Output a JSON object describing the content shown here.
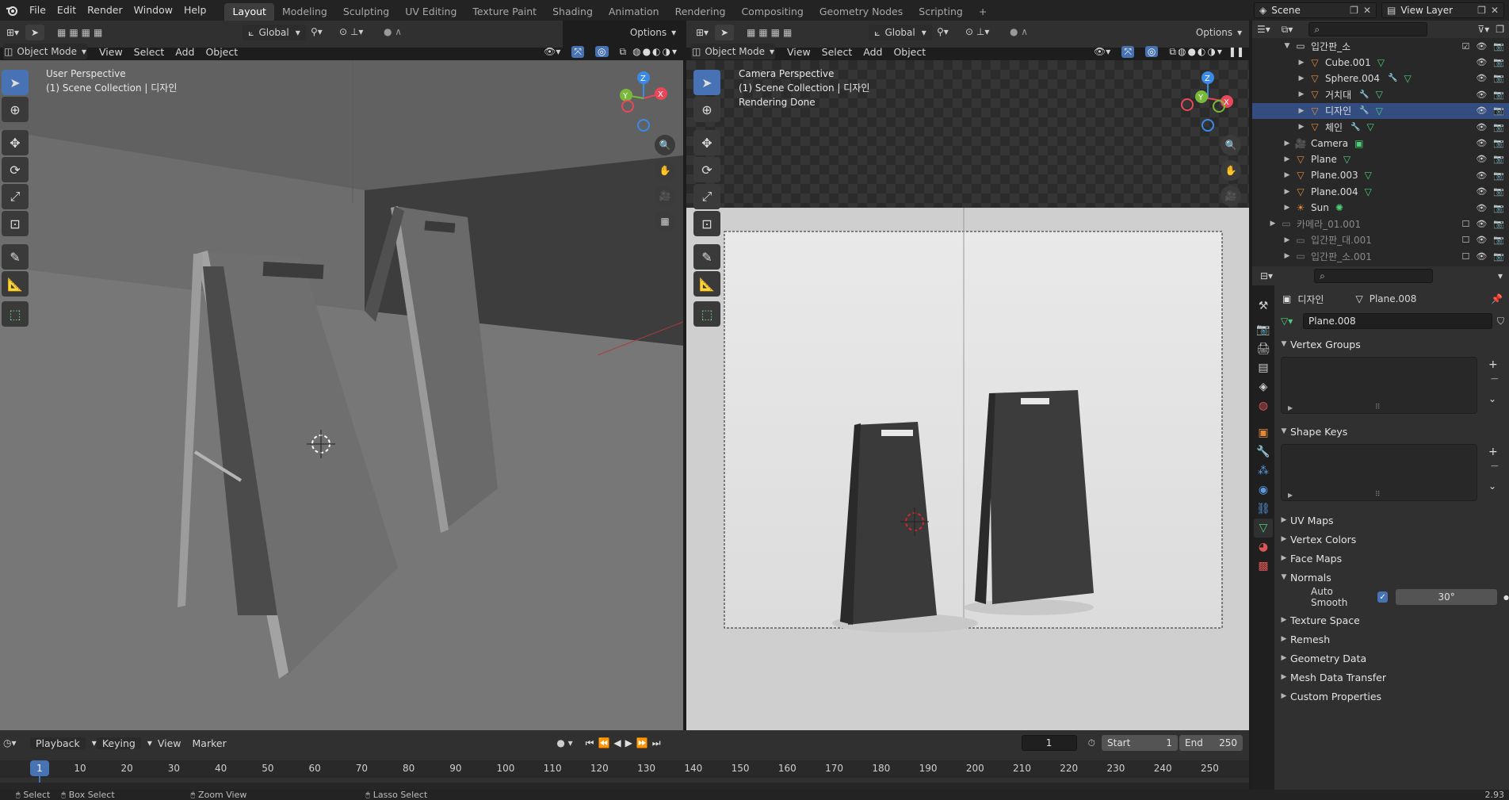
{
  "topbar": {
    "menus": [
      "File",
      "Edit",
      "Render",
      "Window",
      "Help"
    ],
    "workspaces": [
      "Layout",
      "Modeling",
      "Sculpting",
      "UV Editing",
      "Texture Paint",
      "Shading",
      "Animation",
      "Rendering",
      "Compositing",
      "Geometry Nodes",
      "Scripting"
    ],
    "add_tab": "+",
    "scene_label": "Scene",
    "view_layer_label": "View Layer"
  },
  "viewport_left": {
    "mode": "Object Mode",
    "menus": [
      "View",
      "Select",
      "Add",
      "Object"
    ],
    "transform_orientation": "Global",
    "options_label": "Options",
    "perspective": "User Perspective",
    "collection": "(1) Scene Collection | 디자인"
  },
  "viewport_right": {
    "mode": "Object Mode",
    "menus": [
      "View",
      "Select",
      "Add",
      "Object"
    ],
    "transform_orientation": "Global",
    "options_label": "Options",
    "perspective": "Camera Perspective",
    "collection": "(1) Scene Collection | 디자인",
    "status": "Rendering Done"
  },
  "gizmo": {
    "x": "X",
    "y": "Y",
    "z": "Z"
  },
  "outliner": {
    "rows": [
      {
        "name": "입간판_소",
        "indent": 1,
        "type": "collection"
      },
      {
        "name": "Cube.001",
        "indent": 2,
        "type": "mesh"
      },
      {
        "name": "Sphere.004",
        "indent": 2,
        "type": "mesh"
      },
      {
        "name": "거치대",
        "indent": 2,
        "type": "mesh"
      },
      {
        "name": "디자인",
        "indent": 2,
        "type": "mesh",
        "selected": true
      },
      {
        "name": "체인",
        "indent": 2,
        "type": "mesh"
      },
      {
        "name": "Camera",
        "indent": 1,
        "type": "camera"
      },
      {
        "name": "Plane",
        "indent": 1,
        "type": "mesh"
      },
      {
        "name": "Plane.003",
        "indent": 1,
        "type": "mesh"
      },
      {
        "name": "Plane.004",
        "indent": 1,
        "type": "mesh"
      },
      {
        "name": "Sun",
        "indent": 1,
        "type": "light"
      },
      {
        "name": "카메라_01.001",
        "indent": 0,
        "type": "collection",
        "dim": true
      },
      {
        "name": "입간판_대.001",
        "indent": 1,
        "type": "collection",
        "dim": true
      },
      {
        "name": "입간판_소.001",
        "indent": 1,
        "type": "collection",
        "dim": true
      }
    ]
  },
  "properties": {
    "breadcrumb_object": "디자인",
    "breadcrumb_data": "Plane.008",
    "datablock_name": "Plane.008",
    "panels": {
      "vertex_groups": "Vertex Groups",
      "shape_keys": "Shape Keys",
      "uv_maps": "UV Maps",
      "vertex_colors": "Vertex Colors",
      "face_maps": "Face Maps",
      "normals": "Normals",
      "auto_smooth_label": "Auto Smooth",
      "auto_smooth_angle": "30°",
      "texture_space": "Texture Space",
      "remesh": "Remesh",
      "geometry_data": "Geometry Data",
      "mesh_data_transfer": "Mesh Data Transfer",
      "custom_properties": "Custom Properties"
    }
  },
  "timeline": {
    "menus": [
      "Playback",
      "Keying",
      "View",
      "Marker"
    ],
    "current_frame": "1",
    "start_label": "Start",
    "start_value": "1",
    "end_label": "End",
    "end_value": "250",
    "ticks": [
      "10",
      "20",
      "30",
      "40",
      "50",
      "60",
      "70",
      "80",
      "90",
      "100",
      "110",
      "120",
      "130",
      "140",
      "150",
      "160",
      "170",
      "180",
      "190",
      "200",
      "210",
      "220",
      "230",
      "240",
      "250"
    ],
    "playhead": "1"
  },
  "statusbar": {
    "items": [
      "Select",
      "Box Select",
      "Zoom View",
      "Lasso Select"
    ],
    "version": "2.93"
  },
  "colors": {
    "accent": "#4772b3",
    "selected_row": "#334d80",
    "mesh_icon": "#e38a3a",
    "mesh_data_icon": "#4bd07a",
    "gizmo_x": "#e8485a",
    "gizmo_y": "#7ab83a",
    "gizmo_z": "#3a8ae6"
  }
}
